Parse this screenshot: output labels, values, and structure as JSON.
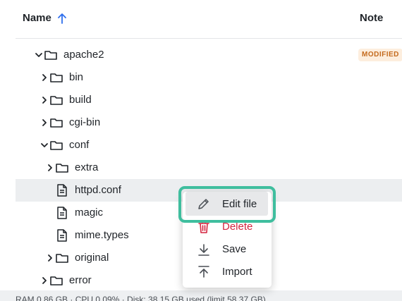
{
  "header": {
    "name_label": "Name",
    "note_label": "Note",
    "sort_direction": "ascending"
  },
  "tree": [
    {
      "label": "apache2",
      "type": "folder",
      "expanded": true,
      "badge": "MODIFIED"
    },
    {
      "label": "bin",
      "type": "folder",
      "expanded": false
    },
    {
      "label": "build",
      "type": "folder",
      "expanded": false
    },
    {
      "label": "cgi-bin",
      "type": "folder",
      "expanded": false
    },
    {
      "label": "conf",
      "type": "folder",
      "expanded": true
    },
    {
      "label": "extra",
      "type": "folder",
      "expanded": false
    },
    {
      "label": "httpd.conf",
      "type": "file",
      "selected": true
    },
    {
      "label": "magic",
      "type": "file"
    },
    {
      "label": "mime.types",
      "type": "file"
    },
    {
      "label": "original",
      "type": "folder",
      "expanded": false
    },
    {
      "label": "error",
      "type": "folder",
      "expanded": false
    }
  ],
  "context_menu": {
    "items": [
      {
        "label": "Edit file",
        "icon": "pencil-icon",
        "highlighted": true
      },
      {
        "label": "Delete",
        "icon": "trash-icon",
        "danger": true
      },
      {
        "label": "Save",
        "icon": "download-icon"
      },
      {
        "label": "Import",
        "icon": "upload-icon"
      }
    ]
  },
  "statusbar": {
    "text": "RAM 0.86 GB · CPU 0.09% · Disk: 38.15 GB used (limit 58.37 GB)"
  },
  "colors": {
    "accent": "#2f6fed",
    "highlight_border": "#3fbe9e",
    "danger": "#d4243f",
    "badge_bg": "#fdeede",
    "badge_text": "#c46a1d",
    "selected_row": "#eceef0"
  }
}
